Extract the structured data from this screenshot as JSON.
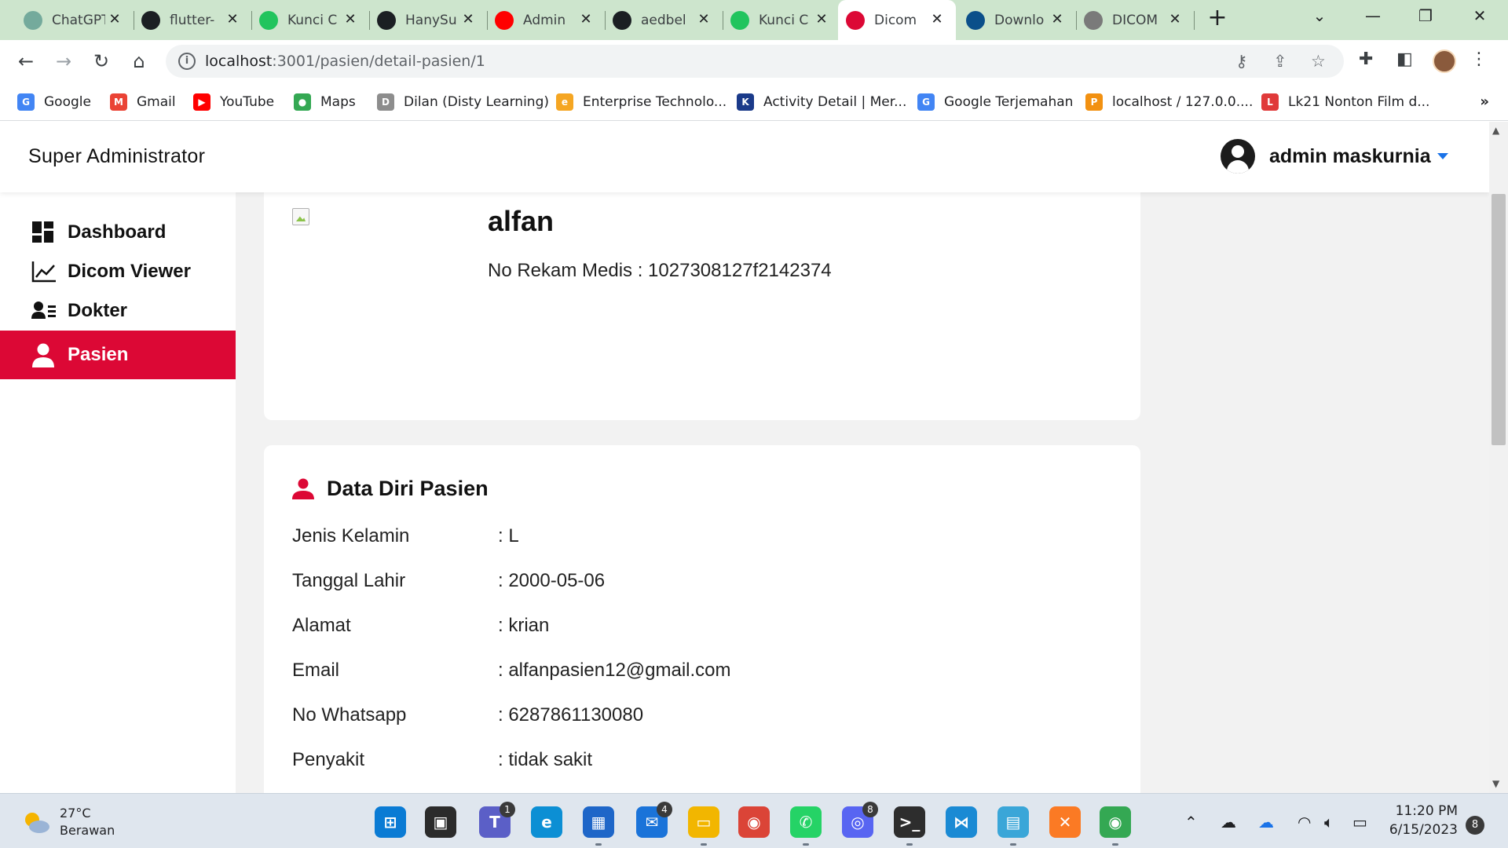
{
  "browser": {
    "tabs": [
      {
        "label": "ChatGPT",
        "icon": "chatgpt-icon",
        "color": "#74aa9c"
      },
      {
        "label": "flutter-",
        "icon": "github-icon",
        "color": "#1b1f23"
      },
      {
        "label": "Kunci C",
        "icon": "copyleaks-icon",
        "color": "#21c45d"
      },
      {
        "label": "HanySu",
        "icon": "github-icon",
        "color": "#1b1f23"
      },
      {
        "label": "Admin",
        "icon": "youtube-icon",
        "color": "#ff0000"
      },
      {
        "label": "aedbel",
        "icon": "github-icon",
        "color": "#1b1f23"
      },
      {
        "label": "Kunci C",
        "icon": "copyleaks-icon",
        "color": "#21c45d"
      },
      {
        "label": "Dicom",
        "icon": "dicom-app-icon",
        "color": "#dc0835",
        "active": true
      },
      {
        "label": "Downlo",
        "icon": "xray-icon",
        "color": "#0b4f8a"
      },
      {
        "label": "DICOM",
        "icon": "dicom-viewer-icon",
        "color": "#7a7a7a"
      }
    ],
    "url_host": "localhost",
    "url_path": ":3001/pasien/detail-pasien/1",
    "bookmarks": [
      {
        "label": "Google",
        "icon": "google-icon",
        "color": "#4285f4",
        "glyph": "G"
      },
      {
        "label": "Gmail",
        "icon": "gmail-icon",
        "color": "#ea4335",
        "glyph": "M"
      },
      {
        "label": "YouTube",
        "icon": "youtube-icon",
        "color": "#ff0000",
        "glyph": "▶"
      },
      {
        "label": "Maps",
        "icon": "maps-icon",
        "color": "#34a853",
        "glyph": "●"
      },
      {
        "label": "Dilan (Disty Learning)",
        "icon": "dilan-icon",
        "color": "#8d8d8d",
        "glyph": "D"
      },
      {
        "label": "Enterprise Technolo...",
        "icon": "enterprise-icon",
        "color": "#f5a623",
        "glyph": "e"
      },
      {
        "label": "Activity Detail | Mer...",
        "icon": "activity-icon",
        "color": "#1a3a8a",
        "glyph": "K"
      },
      {
        "label": "Google Terjemahan",
        "icon": "translate-icon",
        "color": "#4285f4",
        "glyph": "G"
      },
      {
        "label": "localhost / 127.0.0....",
        "icon": "phpmyadmin-icon",
        "color": "#f29111",
        "glyph": "P"
      },
      {
        "label": "Lk21 Nonton Film d...",
        "icon": "lk21-icon",
        "color": "#e03a3a",
        "glyph": "L"
      }
    ],
    "bookmarks_more": "»"
  },
  "app": {
    "brand": "Super Administrator",
    "user_name": "admin maskurnia",
    "accent_color": "#dc0835",
    "nav": [
      {
        "label": "Dashboard",
        "icon": "dashboard-icon"
      },
      {
        "label": "Dicom Viewer",
        "icon": "chart-line-icon"
      },
      {
        "label": "Dokter",
        "icon": "user-list-icon"
      },
      {
        "label": "Pasien",
        "icon": "user-icon",
        "active": true
      }
    ]
  },
  "patient": {
    "name": "alfan",
    "rekam_medis": "No Rekam Medis : 1027308127f2142374",
    "section_title": "Data Diri Pasien",
    "fields": [
      {
        "label": "Jenis Kelamin",
        "value": ": L"
      },
      {
        "label": "Tanggal Lahir",
        "value": ": 2000-05-06"
      },
      {
        "label": "Alamat",
        "value": ": krian"
      },
      {
        "label": "Email",
        "value": ": alfanpasien12@gmail.com"
      },
      {
        "label": "No Whatsapp",
        "value": ": 6287861130080"
      },
      {
        "label": "Penyakit",
        "value": ": tidak sakit"
      }
    ]
  },
  "taskbar": {
    "temperature": "27°C",
    "weather": "Berawan",
    "time": "11:20 PM",
    "date": "6/15/2023",
    "notifications": "8",
    "apps": [
      {
        "name": "start-button",
        "color": "#0a7bd4",
        "glyph": "⊞"
      },
      {
        "name": "task-view-button",
        "color": "#2b2b2b",
        "glyph": "▣"
      },
      {
        "name": "teams-app",
        "color": "#5b5fc7",
        "glyph": "T",
        "badge": "1"
      },
      {
        "name": "edge-app",
        "color": "#0c8fd4",
        "glyph": "e"
      },
      {
        "name": "store-app",
        "color": "#1e66c8",
        "glyph": "▦"
      },
      {
        "name": "mail-app",
        "color": "#1a73d9",
        "glyph": "✉",
        "badge": "4"
      },
      {
        "name": "file-explorer-app",
        "color": "#f2b600",
        "glyph": "▭"
      },
      {
        "name": "chrome-app",
        "color": "#db4437",
        "glyph": "◉"
      },
      {
        "name": "whatsapp-app",
        "color": "#25d366",
        "glyph": "✆"
      },
      {
        "name": "discord-app",
        "color": "#5865f2",
        "glyph": "◎",
        "badge": "8"
      },
      {
        "name": "terminal-app",
        "color": "#2d2d2d",
        "glyph": ">_"
      },
      {
        "name": "vscode-app",
        "color": "#1a8ad4",
        "glyph": "⋈"
      },
      {
        "name": "remote-desktop-app",
        "color": "#3aa6d8",
        "glyph": "▤"
      },
      {
        "name": "xampp-app",
        "color": "#fb7a24",
        "glyph": "✕"
      },
      {
        "name": "chrome-profile-app",
        "color": "#34a853",
        "glyph": "◉"
      }
    ]
  }
}
